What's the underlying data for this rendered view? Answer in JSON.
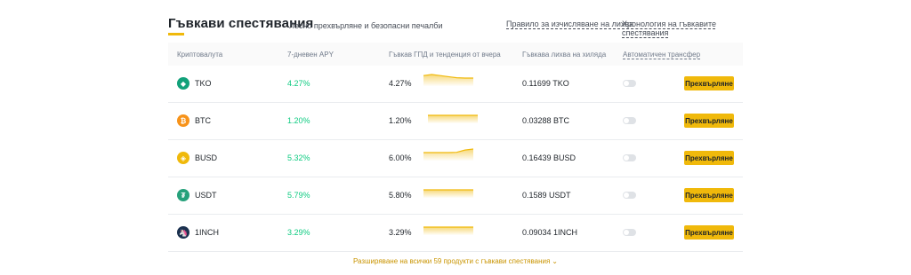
{
  "header": {
    "title": "Гъвкави спестявания",
    "subtitle": "Лесно прехвърляне и безопасни печалби",
    "link_rule": "Правило за изчисляване на лихва",
    "link_history": "Хронология на гъвкавите спестявания"
  },
  "table": {
    "columns": [
      "Криптовалута",
      "7-дневен APY",
      "Гъвкав ГПД и тенденция от вчера",
      "Гъвкава лихва на хиляда",
      "Автоматичен трансфер"
    ],
    "rows": [
      {
        "coin": "TKO",
        "apy": "4.27%",
        "apr": "4.27%",
        "interest": "0.11699 TKO",
        "icon": "tko-icon",
        "icon_color": "#12a17a",
        "button": "Прехвърляне",
        "trend": [
          4.5,
          4.6,
          4.5,
          4.4,
          4.3,
          4.27,
          4.27
        ]
      },
      {
        "coin": "BTC",
        "apy": "1.20%",
        "apr": "1.20%",
        "interest": "0.03288 BTC",
        "icon": "bitcoin-icon",
        "icon_color": "#f7931a",
        "button": "Прехвърляне",
        "trend": [
          1.2,
          1.2,
          1.2,
          1.2,
          1.2,
          1.2,
          1.2
        ]
      },
      {
        "coin": "BUSD",
        "apy": "5.32%",
        "apr": "6.00%",
        "interest": "0.16439 BUSD",
        "icon": "busd-icon",
        "icon_color": "#f0b90b",
        "button": "Прехвърляне",
        "trend": [
          5.3,
          5.3,
          5.3,
          5.3,
          5.35,
          5.8,
          6.0
        ]
      },
      {
        "coin": "USDT",
        "apy": "5.79%",
        "apr": "5.80%",
        "interest": "0.1589 USDT",
        "icon": "tether-icon",
        "icon_color": "#26a17b",
        "button": "Прехвърляне",
        "trend": [
          5.8,
          5.8,
          5.8,
          5.8,
          5.8,
          5.8,
          5.8
        ]
      },
      {
        "coin": "1INCH",
        "apy": "3.29%",
        "apr": "3.29%",
        "interest": "0.09034 1INCH",
        "icon": "1inch-icon",
        "icon_color": "#1b314f",
        "button": "Прехвърляне",
        "trend": [
          3.29,
          3.29,
          3.29,
          3.29,
          3.29,
          3.29,
          3.29
        ]
      }
    ]
  },
  "expand_label": "Разширяване на всички 59 продукти с гъвкави спестявания",
  "colors": {
    "accent": "#f0b90b",
    "positive": "#0ecb81",
    "link_accent": "#c99400"
  }
}
